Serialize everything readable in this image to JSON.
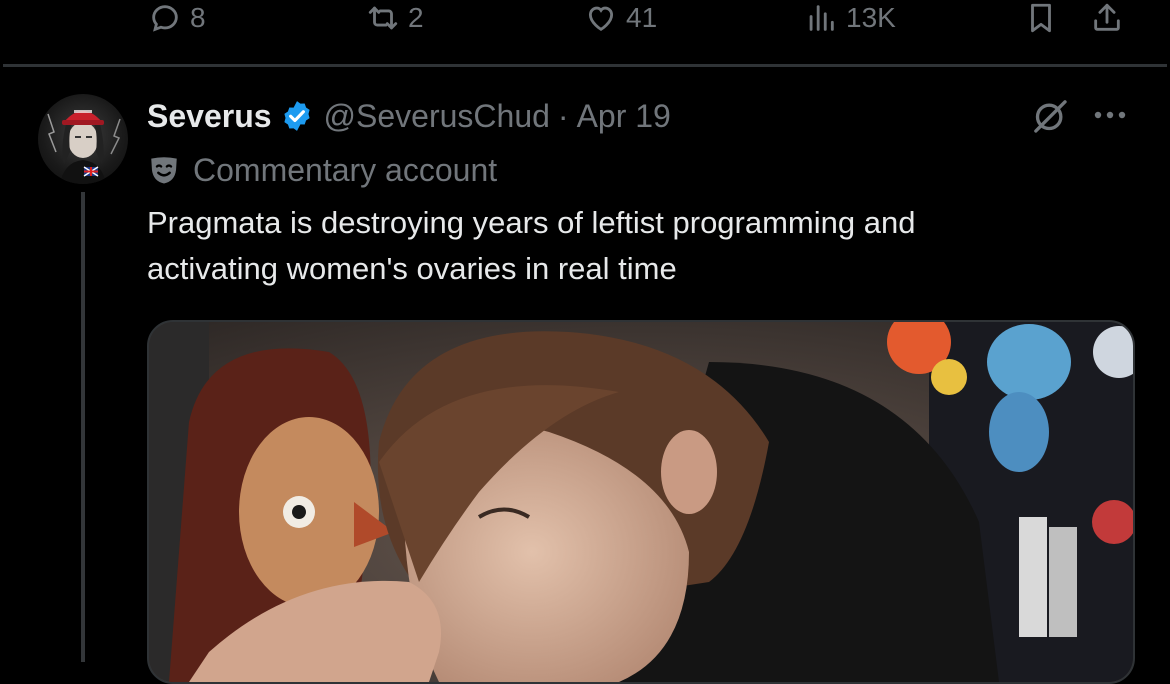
{
  "action_bar": {
    "replies": "8",
    "reposts": "2",
    "likes": "41",
    "views": "13K"
  },
  "tweet": {
    "display_name": "Severus",
    "handle": "@SeverusChud",
    "separator": "·",
    "date": "Apr 19",
    "account_label": "Commentary account",
    "text_lines": [
      "Pragmata is destroying years of leftist programming and",
      "activating women's ovaries in real time"
    ]
  },
  "colors": {
    "background": "#000000",
    "text_primary": "#e7e9ea",
    "text_secondary": "#71767b",
    "verified_blue": "#1d9bf0",
    "border": "#2f3336"
  },
  "icons": [
    "reply-icon",
    "repost-icon",
    "like-icon",
    "views-icon",
    "bookmark-icon",
    "share-icon",
    "verified-badge-icon",
    "grok-icon",
    "more-icon",
    "commentary-mask-icon"
  ]
}
